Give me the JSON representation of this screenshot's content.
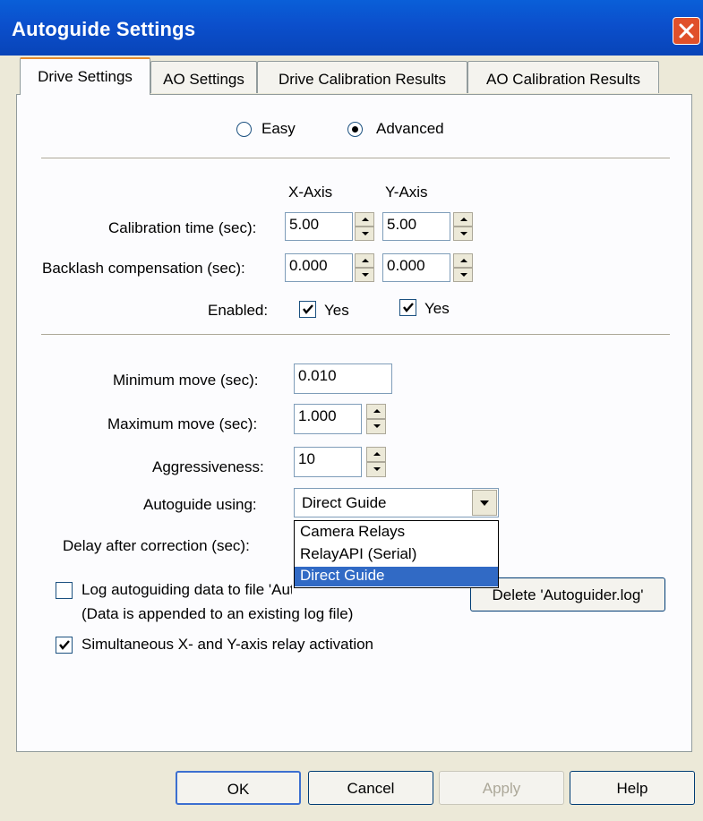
{
  "window": {
    "title": "Autoguide Settings"
  },
  "tabs": [
    {
      "label": "Drive Settings",
      "active": true
    },
    {
      "label": "AO Settings",
      "active": false
    },
    {
      "label": "Drive Calibration Results",
      "active": false
    },
    {
      "label": "AO Calibration Results",
      "active": false
    }
  ],
  "mode": {
    "options": [
      {
        "label": "Easy",
        "selected": false
      },
      {
        "label": "Advanced",
        "selected": true
      }
    ]
  },
  "calibration": {
    "x_header": "X-Axis",
    "y_header": "Y-Axis",
    "calibration_time_label": "Calibration time (sec):",
    "calibration_time_x": "5.00",
    "calibration_time_y": "5.00",
    "backlash_label": "Backlash compensation (sec):",
    "backlash_x": "0.000",
    "backlash_y": "0.000",
    "enabled_label": "Enabled:",
    "enabled_x": {
      "label": "Yes",
      "checked": true
    },
    "enabled_y": {
      "label": "Yes",
      "checked": true
    }
  },
  "moves": {
    "min_label": "Minimum move (sec):",
    "min_value": "0.010",
    "max_label": "Maximum move (sec):",
    "max_value": "1.000",
    "aggr_label": "Aggressiveness:",
    "aggr_value": "10",
    "autoguide_label": "Autoguide using:",
    "autoguide_value": "Direct Guide",
    "autoguide_options": [
      "Camera Relays",
      "RelayAPI (Serial)",
      "Direct Guide"
    ],
    "autoguide_selected_index": 2,
    "delay_label": "Delay after correction (sec):"
  },
  "log": {
    "label": "Log autoguiding data to file 'Autoguider.log'",
    "note": "(Data is appended to an existing log file)",
    "checked": false,
    "delete_button": "Delete 'Autoguider.log'"
  },
  "simultaneous": {
    "label": "Simultaneous X- and Y-axis relay activation",
    "checked": true
  },
  "buttons": {
    "ok": "OK",
    "cancel": "Cancel",
    "apply": "Apply",
    "help": "Help"
  },
  "colors": {
    "titlebar": "#0b4fcc",
    "selection": "#316ac5",
    "face": "#ece9d8"
  }
}
